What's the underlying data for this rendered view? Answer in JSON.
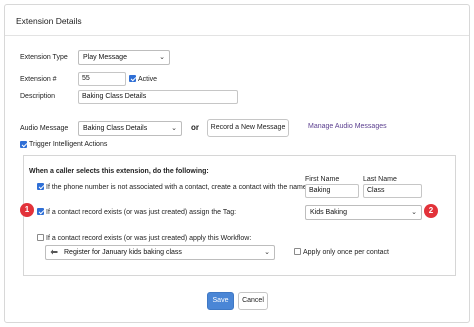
{
  "panel": {
    "title": "Extension Details"
  },
  "form": {
    "extension_type": {
      "label": "Extension Type",
      "value": "Play Message"
    },
    "extension_number": {
      "label": "Extension #",
      "value": "55",
      "active_label": "Active",
      "active": true
    },
    "description": {
      "label": "Description",
      "value": "Baking Class Details"
    },
    "audio_message": {
      "label": "Audio Message",
      "value": "Baking Class Details",
      "or_label": "or",
      "record_label": "Record a New Message",
      "manage_link": "Manage Audio Messages"
    },
    "trigger": {
      "label": "Trigger Intelligent Actions",
      "checked": true
    }
  },
  "actions": {
    "heading": "When a caller selects this extension, do the following:",
    "create_contact": {
      "label": "If the phone number is not associated with a contact, create a contact with the name:",
      "checked": true,
      "first_name_label": "First Name",
      "last_name_label": "Last Name",
      "first_name": "Baking",
      "last_name": "Class"
    },
    "assign_tag": {
      "label": "If a contact record exists (or was just created) assign the Tag:",
      "checked": true,
      "tag": "Kids Baking"
    },
    "apply_workflow": {
      "label": "If a contact record exists (or was just created) apply this Workflow:",
      "checked": false,
      "workflow": "Register for January kids baking class",
      "once_label": "Apply only once per contact",
      "once_checked": false
    }
  },
  "annotations": {
    "badge_1": "1",
    "badge_2": "2"
  },
  "buttons": {
    "save": "Save",
    "cancel": "Cancel"
  },
  "icons": {
    "dropdown": "chevron-down-icon",
    "workflow": "workflow-icon",
    "check": "checkbox-check-icon"
  },
  "colors": {
    "primary": "#4a86d6",
    "checkbox": "#2f6fd6",
    "badge": "#e2323a",
    "link": "#5b3f8f"
  }
}
